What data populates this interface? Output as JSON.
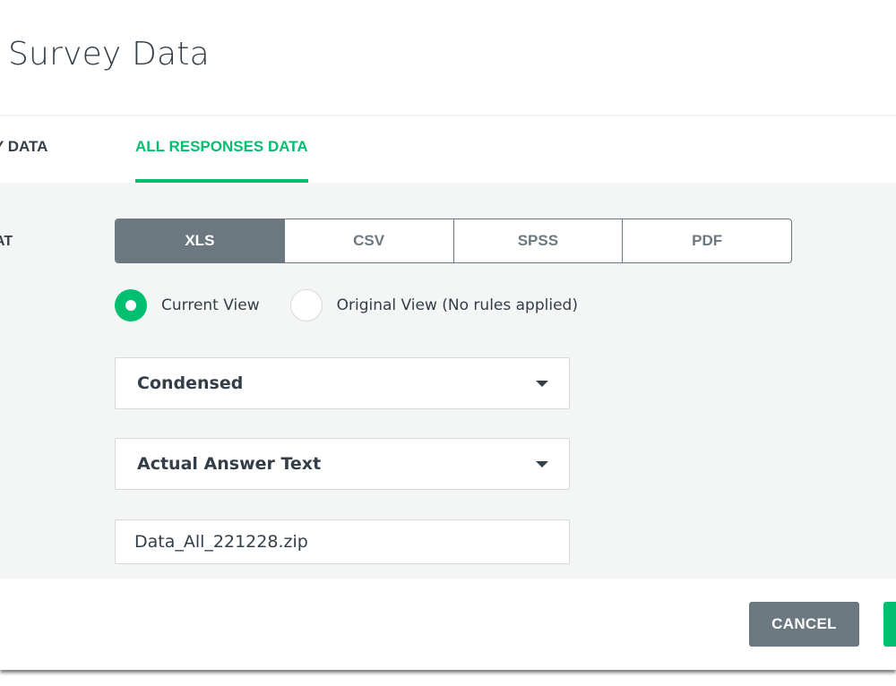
{
  "dialog": {
    "title": "Survey Data"
  },
  "tabs": [
    {
      "label": "Y DATA",
      "active": false
    },
    {
      "label": "ALL RESPONSES DATA",
      "active": true
    }
  ],
  "form": {
    "format_label": "AT",
    "formats": [
      {
        "label": "XLS",
        "selected": true
      },
      {
        "label": "CSV",
        "selected": false
      },
      {
        "label": "SPSS",
        "selected": false
      },
      {
        "label": "PDF",
        "selected": false
      }
    ],
    "view_options": [
      {
        "label": "Current View",
        "checked": true
      },
      {
        "label": "Original View (No rules applied)",
        "checked": false
      }
    ],
    "layout_select": {
      "value": "Condensed"
    },
    "answer_select": {
      "value": "Actual Answer Text"
    },
    "filename_input": {
      "value": "Data_All_221228.zip"
    }
  },
  "footer": {
    "cancel_label": "CANCEL",
    "export_label": ""
  },
  "colors": {
    "accent": "#00bf6f",
    "neutral_button": "#6b787f",
    "text": "#333e48"
  }
}
